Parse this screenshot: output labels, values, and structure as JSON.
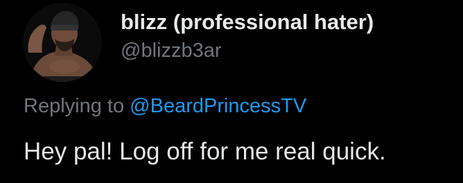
{
  "tweet": {
    "author": {
      "display_name": "blizz (professional hater)",
      "handle": "@blizzb3ar",
      "avatar_icon": "profile-photo"
    },
    "reply": {
      "prefix": "Replying to ",
      "mention": "@BeardPrincessTV"
    },
    "text": "Hey pal! Log off for me real quick."
  },
  "colors": {
    "background": "#000000",
    "primary_text": "#e7e9ea",
    "secondary_text": "#71767b",
    "link": "#1d9bf0"
  }
}
